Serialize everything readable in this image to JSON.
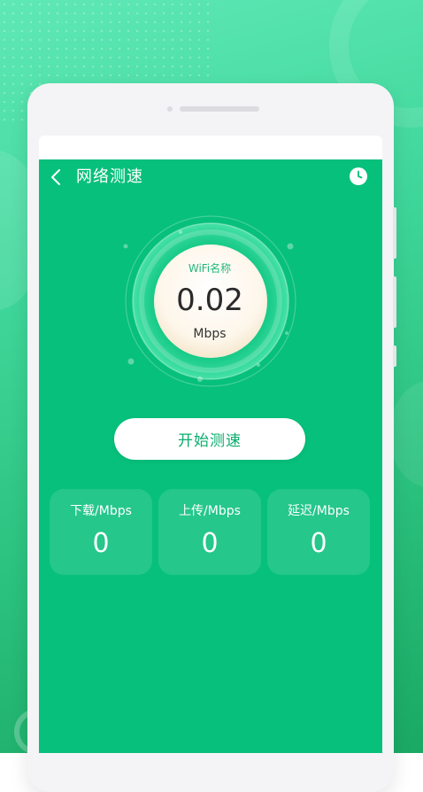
{
  "header": {
    "title": "网络测速",
    "back_icon": "chevron-left-icon",
    "history_icon": "clock-icon"
  },
  "gauge": {
    "wifi_name": "WiFi名称",
    "speed_value": "0.02",
    "speed_unit": "Mbps"
  },
  "start_button": {
    "label": "开始测速"
  },
  "stats": [
    {
      "label": "下载/Mbps",
      "value": "0"
    },
    {
      "label": "上传/Mbps",
      "value": "0"
    },
    {
      "label": "延迟/Mbps",
      "value": "0"
    }
  ],
  "colors": {
    "screen_bg": "#07c07b",
    "accent_text": "#23b978",
    "button_text": "#0aad6e"
  }
}
